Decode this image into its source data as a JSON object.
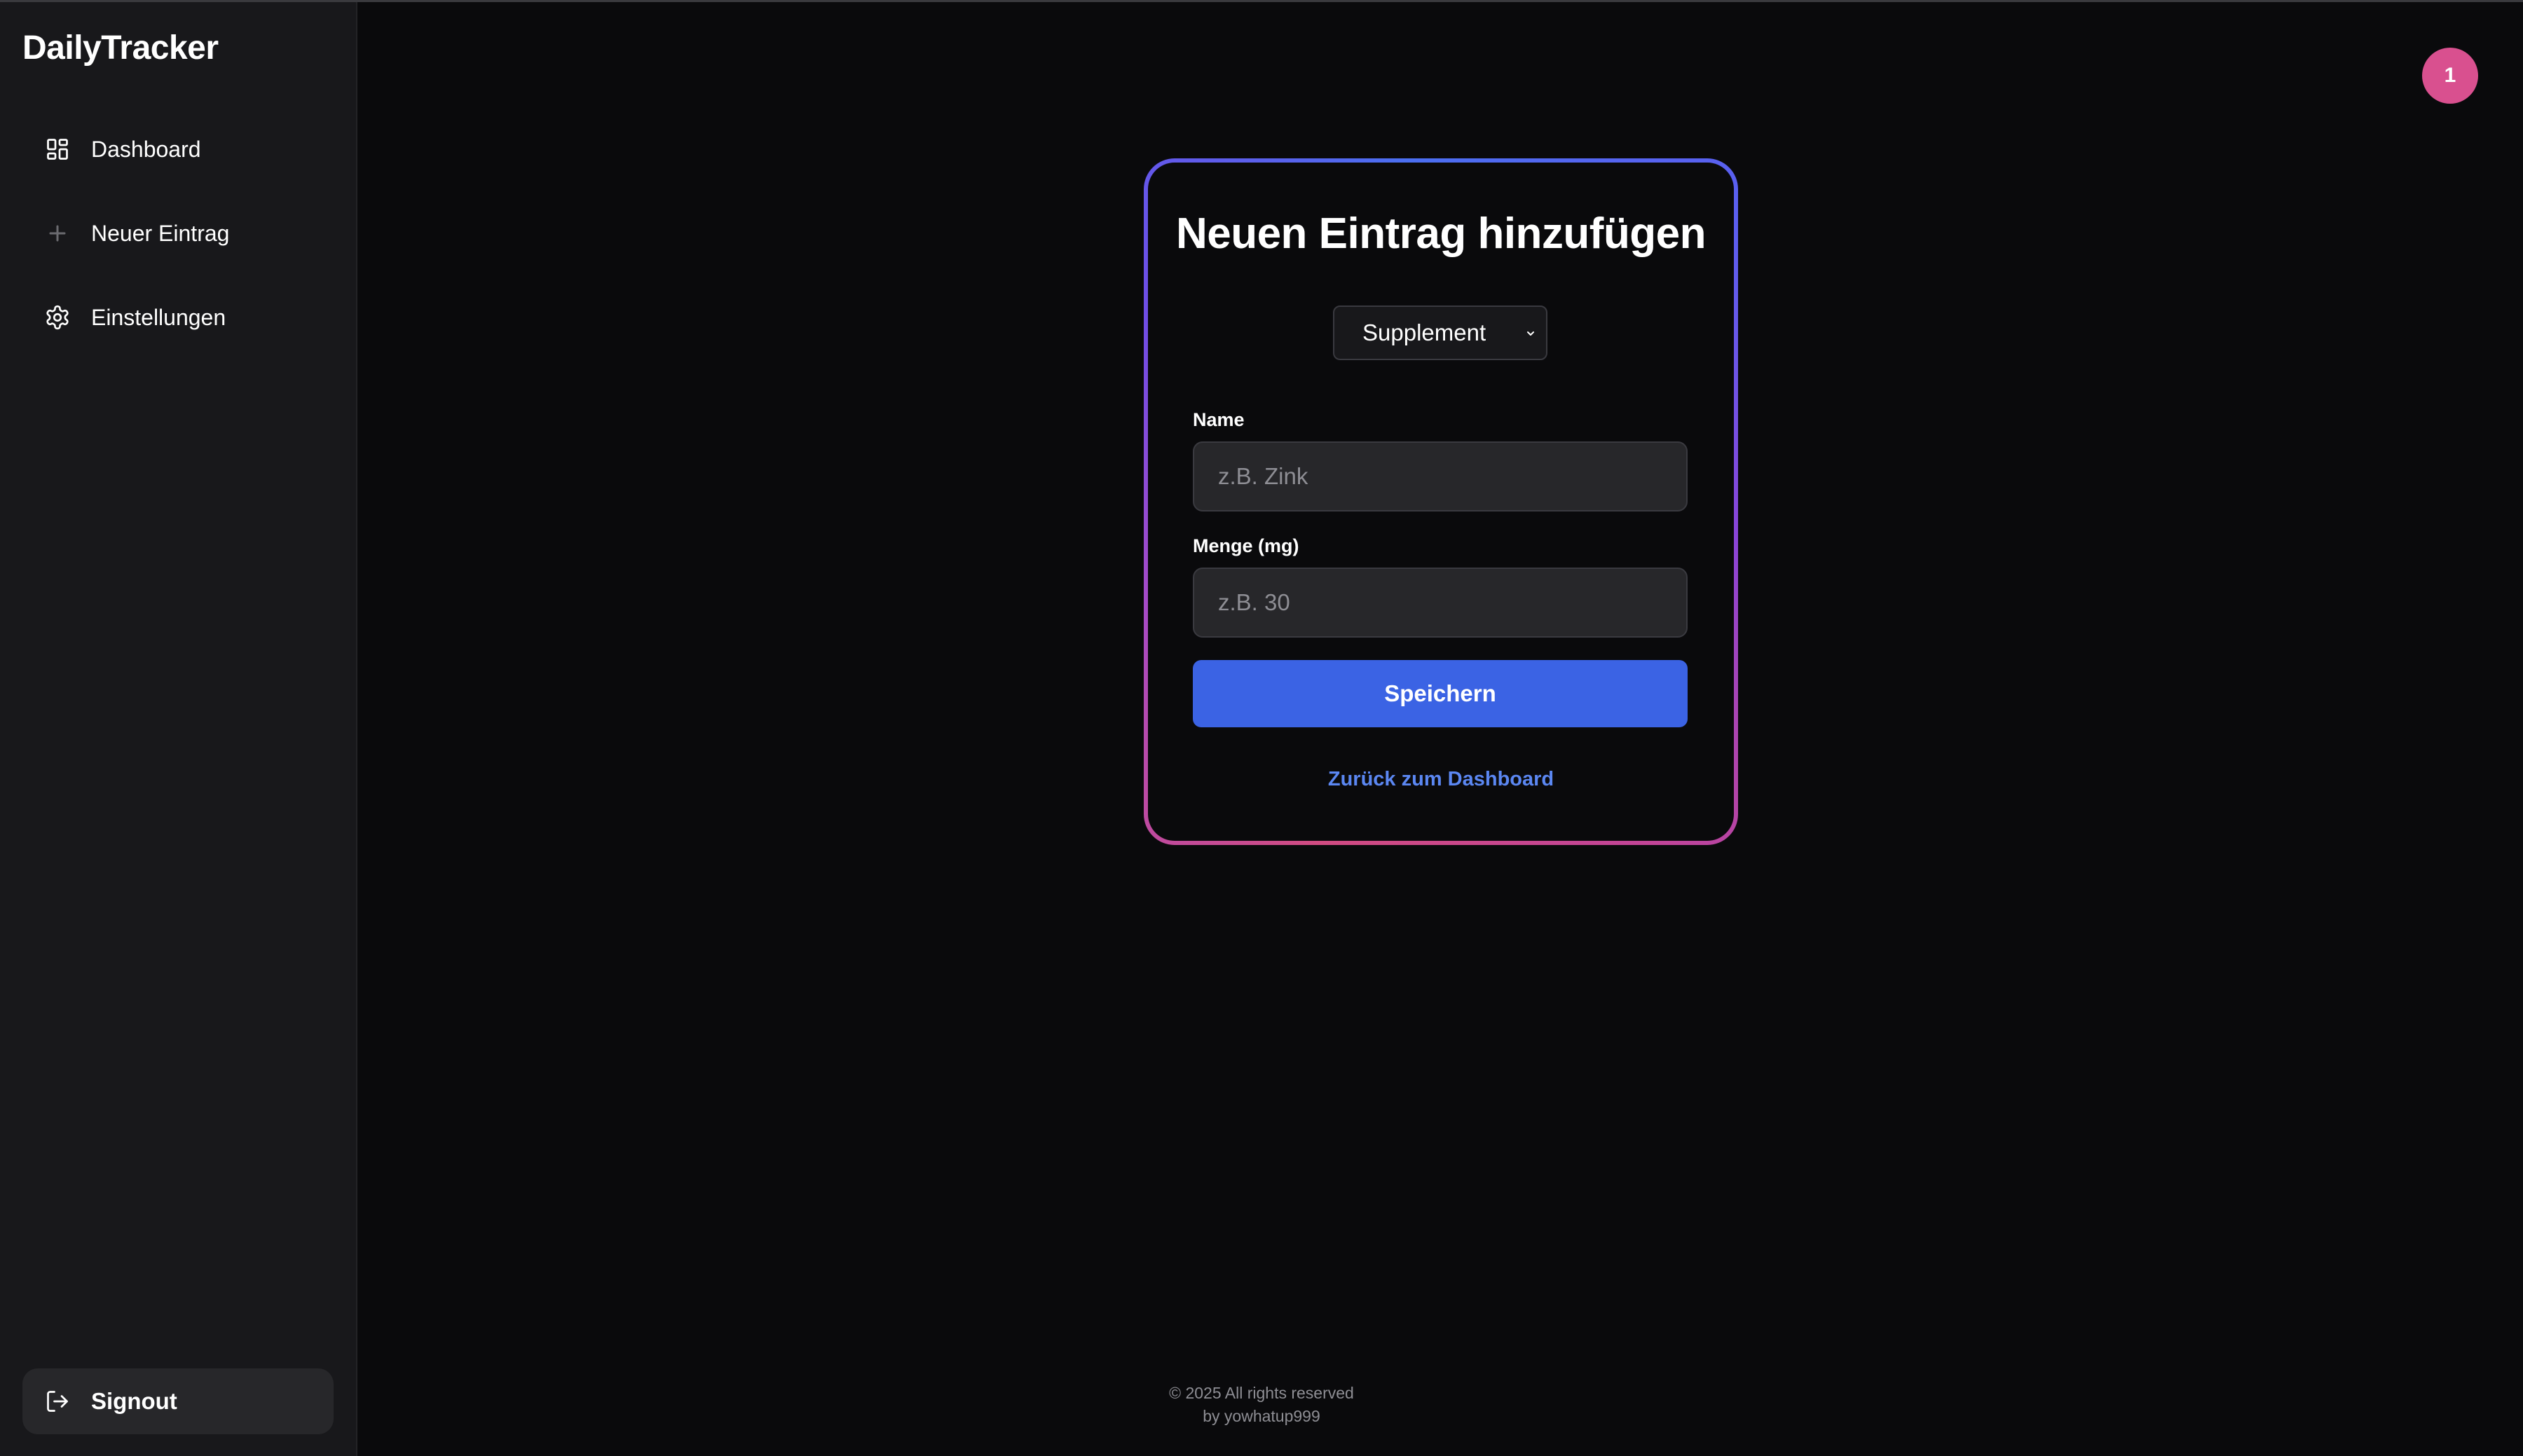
{
  "app": {
    "brand": "DailyTracker"
  },
  "sidebar": {
    "items": [
      {
        "label": "Dashboard",
        "icon": "dashboard-grid-icon"
      },
      {
        "label": "Neuer Eintrag",
        "icon": "plus-icon"
      },
      {
        "label": "Einstellungen",
        "icon": "gear-icon"
      }
    ],
    "signout": {
      "label": "Signout",
      "icon": "sign-out-icon"
    }
  },
  "header": {
    "avatar_text": "1",
    "avatar_color": "#d9508f"
  },
  "form": {
    "title": "Neuen Eintrag hinzufügen",
    "type_select": {
      "selected": "Supplement"
    },
    "name_label": "Name",
    "name_placeholder": "z.B. Zink",
    "name_value": "",
    "amount_label": "Menge (mg)",
    "amount_placeholder": "z.B. 30",
    "amount_value": "",
    "save_label": "Speichern",
    "back_link": "Zurück zum Dashboard"
  },
  "footer": {
    "copyright": "© 2025 All rights reserved",
    "author": "by yowhatup999"
  },
  "colors": {
    "accent": "#3b63e4",
    "link": "#5b87f2",
    "background": "#0a0a0c",
    "sidebar_bg": "#18181b"
  }
}
